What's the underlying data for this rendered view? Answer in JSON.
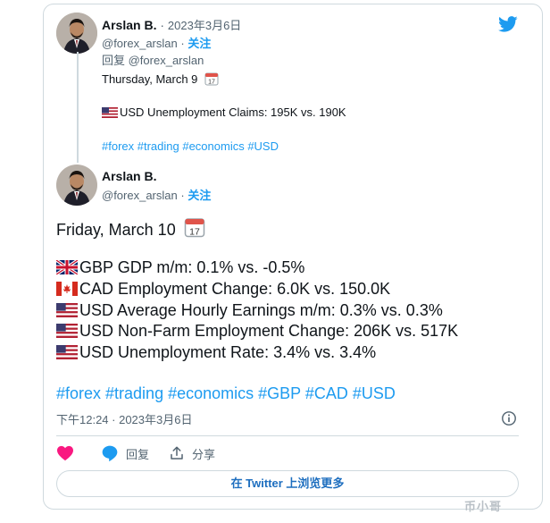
{
  "reply_tweet": {
    "name": "Arslan B.",
    "date": "2023年3月6日",
    "handle": "@forex_arslan",
    "follow": "关注",
    "reply_to": "回复 @forex_arslan",
    "day": "Thursday, March 9",
    "claims": "USD Unemployment Claims: 195K vs. 190K",
    "tags": "#forex #trading #economics #USD"
  },
  "main_tweet": {
    "name": "Arslan B.",
    "handle": "@forex_arslan",
    "follow": "关注",
    "day": "Friday, March 10",
    "lines": [
      "GBP GDP m/m: 0.1% vs. -0.5%",
      "CAD Employment Change: 6.0K vs. 150.0K",
      "USD Average Hourly Earnings m/m: 0.3% vs. 0.3%",
      "USD Non-Farm Employment Change: 206K vs. 517K",
      "USD Unemployment Rate: 3.4% vs. 3.4%"
    ],
    "tags": "#forex #trading #economics #GBP #CAD #USD",
    "timestamp": "下午12:24 · 2023年3月6日"
  },
  "actions": {
    "reply": "回复",
    "share": "分享"
  },
  "more_button": "在 Twitter 上浏览更多",
  "watermark": "币小哥",
  "colors": {
    "accent": "#1d9bf0",
    "like": "#f91880",
    "text": "#0f1419",
    "muted": "#536471"
  }
}
